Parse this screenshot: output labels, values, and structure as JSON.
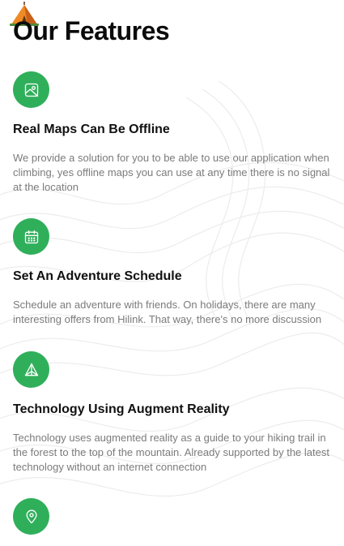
{
  "page_title": "Our Features",
  "accent_color": "#30af5b",
  "features": [
    {
      "icon": "map-icon",
      "title": "Real Maps Can Be Offline",
      "description": "We provide a solution for you to be able to use our application when climbing, yes offline maps you can use at any time there is no signal at the location"
    },
    {
      "icon": "calendar-icon",
      "title": "Set An Adventure Schedule",
      "description": "Schedule an adventure with friends. On holidays, there are many interesting offers from Hilink. That way, there's no more discussion"
    },
    {
      "icon": "tent-triangle-icon",
      "title": "Technology Using Augment Reality",
      "description": "Technology uses augmented reality as a guide to your hiking trail in the forest to the top of the mountain. Already supported by the latest technology without an internet connection"
    },
    {
      "icon": "location-pin-icon",
      "title": "",
      "description": ""
    }
  ]
}
